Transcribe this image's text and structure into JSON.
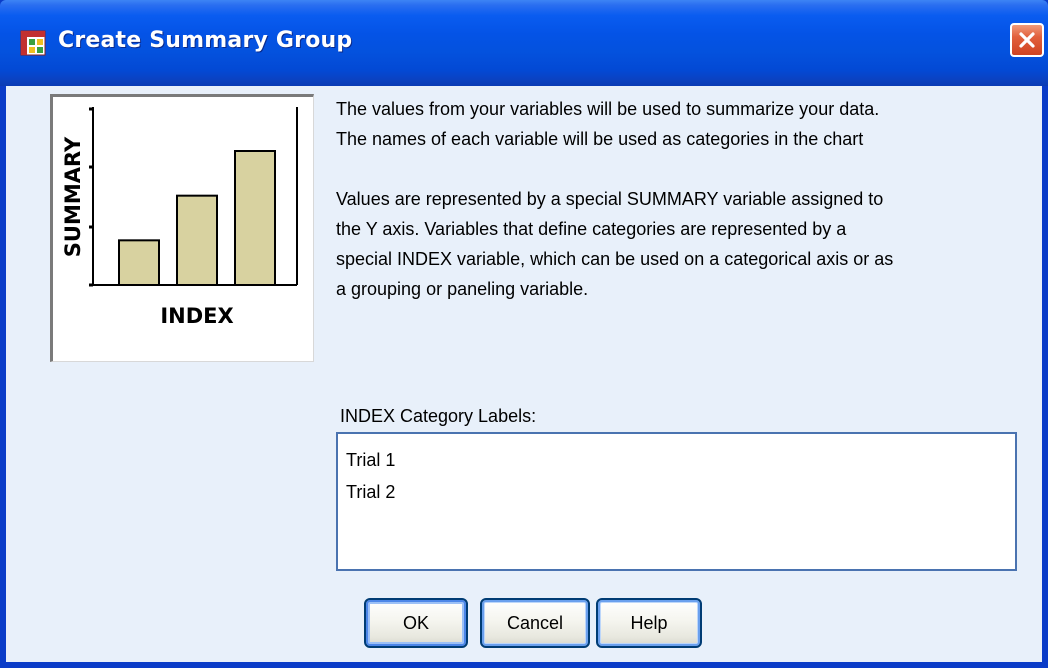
{
  "window": {
    "title": "Create Summary Group",
    "app_icon": "spreadsheet-grid-icon",
    "close_icon": "close-icon"
  },
  "preview": {
    "y_axis_label": "SUMMARY",
    "x_axis_label": "INDEX",
    "bar_values": [
      1,
      2,
      3
    ],
    "bar_color": "#d8d2a0"
  },
  "description": {
    "paragraph1": [
      "The values from your variables will be used to summarize your data.",
      "The names of each variable will be used as categories in the chart"
    ],
    "paragraph2": [
      "Values are represented by a special SUMMARY variable assigned to",
      "the Y axis. Variables that define categories are represented by a",
      "special INDEX variable, which can be used on a categorical axis or as",
      "a grouping or paneling variable."
    ]
  },
  "category_labels": {
    "caption": "INDEX Category Labels:",
    "items": [
      "Trial 1",
      "Trial 2"
    ]
  },
  "buttons": {
    "ok": "OK",
    "cancel": "Cancel",
    "help": "Help"
  }
}
